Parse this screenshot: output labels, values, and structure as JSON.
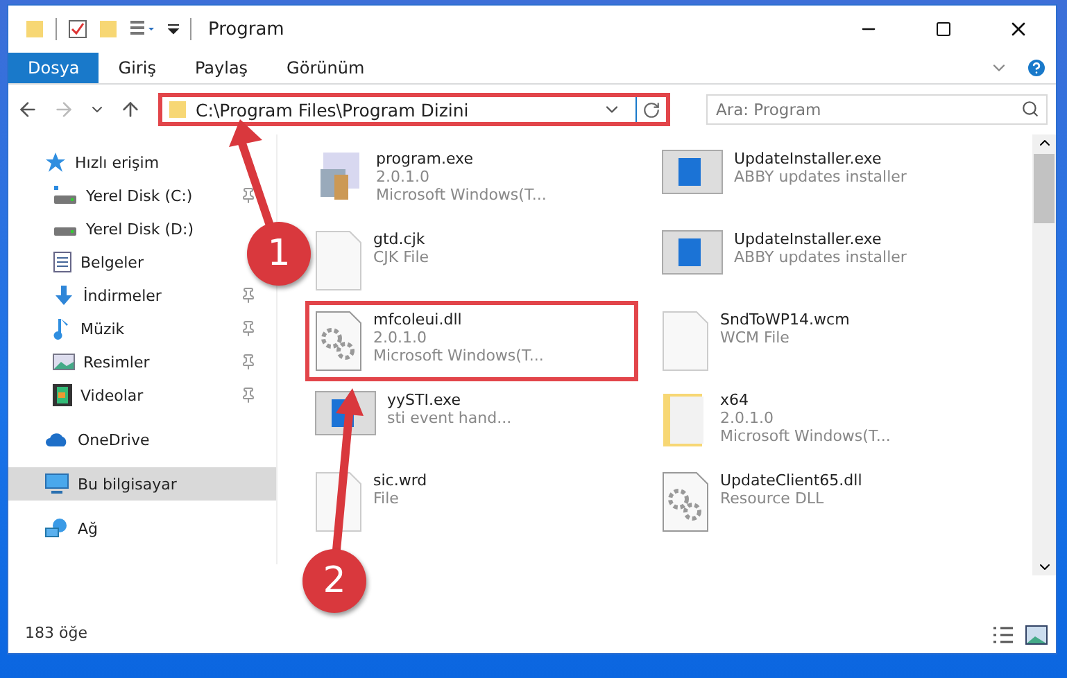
{
  "window": {
    "title": "Program"
  },
  "ribbon": {
    "tabs": [
      {
        "label": "Dosya",
        "selected": true
      },
      {
        "label": "Giriş",
        "selected": false
      },
      {
        "label": "Paylaş",
        "selected": false
      },
      {
        "label": "Görünüm",
        "selected": false
      }
    ]
  },
  "address_bar": {
    "path": "C:\\Program Files\\Program Dizini",
    "highlighted": true
  },
  "search": {
    "placeholder": "Ara: Program"
  },
  "sidebar": {
    "items": [
      {
        "label": "Hızlı erişim",
        "kind": "star",
        "selected": false,
        "children": [
          {
            "label": "Yerel Disk (C:)",
            "kind": "system-drive",
            "pinned": true,
            "selected": false
          },
          {
            "label": "Yerel Disk (D:)",
            "kind": "drive",
            "pinned": false,
            "selected": false
          },
          {
            "label": "Belgeler",
            "kind": "documents",
            "pinned": false,
            "selected": false
          },
          {
            "label": "İndirmeler",
            "kind": "download",
            "pinned": true,
            "selected": false
          },
          {
            "label": "Müzik",
            "kind": "music",
            "pinned": true,
            "selected": false
          },
          {
            "label": "Resimler",
            "kind": "pictures",
            "pinned": true,
            "selected": false
          },
          {
            "label": "Videolar",
            "kind": "videos",
            "pinned": true,
            "selected": false
          }
        ]
      },
      {
        "label": "OneDrive",
        "kind": "cloud",
        "selected": false
      },
      {
        "label": "Bu bilgisayar",
        "kind": "computer",
        "selected": true
      },
      {
        "label": "Ağ",
        "kind": "network",
        "selected": false
      }
    ]
  },
  "files": [
    {
      "name": "program.exe",
      "details": [
        "2.0.1.0",
        "Microsoft Windows(T..."
      ],
      "kind": "program",
      "highlighted": false
    },
    {
      "name": "UpdateInstaller.exe",
      "details": [
        "ABBY updates installer"
      ],
      "kind": "installer",
      "highlighted": false
    },
    {
      "name": "gtd.cjk",
      "details": [
        "CJK File"
      ],
      "kind": "blank",
      "highlighted": false
    },
    {
      "name": "UpdateInstaller.exe",
      "details": [
        "ABBY updates installer"
      ],
      "kind": "installer",
      "highlighted": false
    },
    {
      "name": "mfcoleui.dll",
      "details": [
        "2.0.1.0",
        "Microsoft Windows(T..."
      ],
      "kind": "dll",
      "highlighted": true
    },
    {
      "name": "SndToWP14.wcm",
      "details": [
        "WCM File"
      ],
      "kind": "blank",
      "highlighted": false
    },
    {
      "name": "yySTI.exe",
      "details": [
        "sti event hand..."
      ],
      "kind": "installer",
      "highlighted": false
    },
    {
      "name": "x64",
      "details": [
        "2.0.1.0",
        "Microsoft Windows(T..."
      ],
      "kind": "folder",
      "highlighted": false
    },
    {
      "name": "sic.wrd",
      "details": [
        "File"
      ],
      "kind": "blank",
      "highlighted": false
    },
    {
      "name": "UpdateClient65.dll",
      "details": [
        "Resource DLL"
      ],
      "kind": "dll",
      "highlighted": false
    }
  ],
  "status_bar": {
    "count": "183 öğe"
  },
  "annotations": [
    {
      "number": "1"
    },
    {
      "number": "2"
    }
  ]
}
